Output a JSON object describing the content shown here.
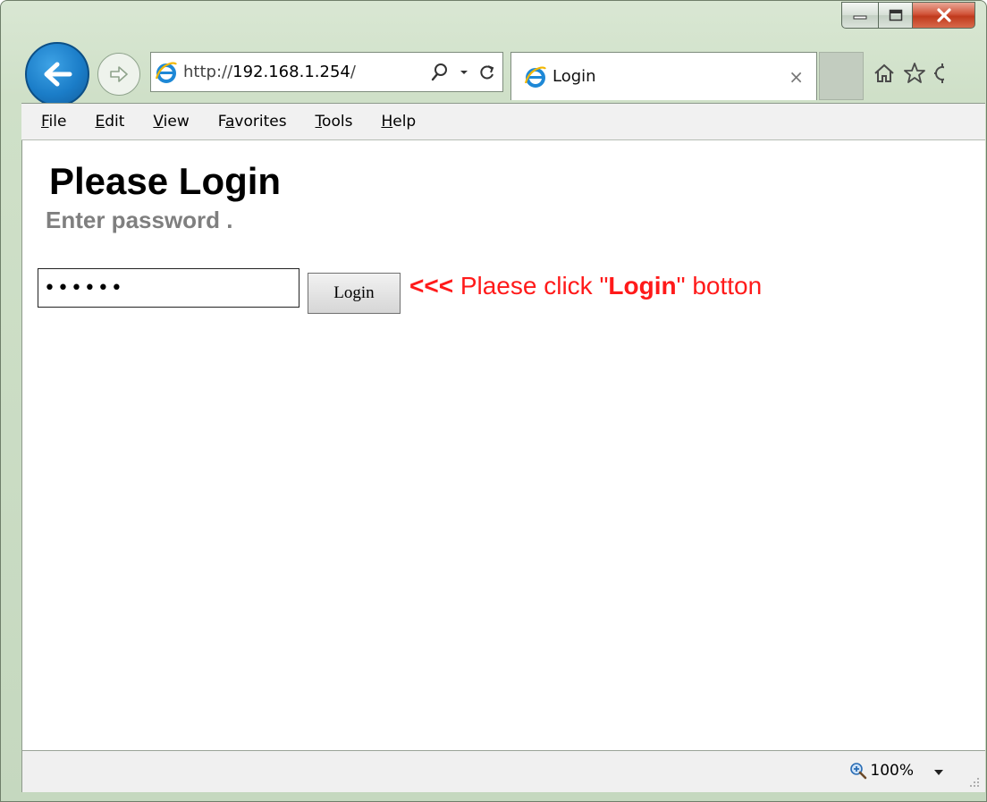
{
  "browser": {
    "address": {
      "scheme": "http://",
      "host": "192.168.1.254",
      "path": "/"
    },
    "tab": {
      "title": "Login",
      "close_glyph": "×"
    },
    "icons": {
      "back": "back-arrow-icon",
      "forward": "forward-arrow-icon",
      "search": "search-icon",
      "refresh": "refresh-icon",
      "home": "home-icon",
      "favorites": "star-icon",
      "settings": "gear-icon"
    },
    "accent_color": "#1b7dc8"
  },
  "menu": {
    "items": [
      {
        "u": "F",
        "rest": "ile"
      },
      {
        "u": "E",
        "rest": "dit"
      },
      {
        "u": "V",
        "rest": "iew"
      },
      {
        "pre": "F",
        "u": "a",
        "rest": "vorites"
      },
      {
        "u": "T",
        "rest": "ools"
      },
      {
        "u": "H",
        "rest": "elp"
      }
    ]
  },
  "page": {
    "title": "Please Login",
    "subtitle": "Enter password .",
    "password_value": "••••••",
    "login_button": "Login",
    "hint": {
      "prefix": "<<<",
      "text_before": " Plaese click \"",
      "bold": "Login",
      "text_after": "\" botton"
    },
    "hint_color": "#ff1a1a"
  },
  "status": {
    "zoom": "100%"
  }
}
